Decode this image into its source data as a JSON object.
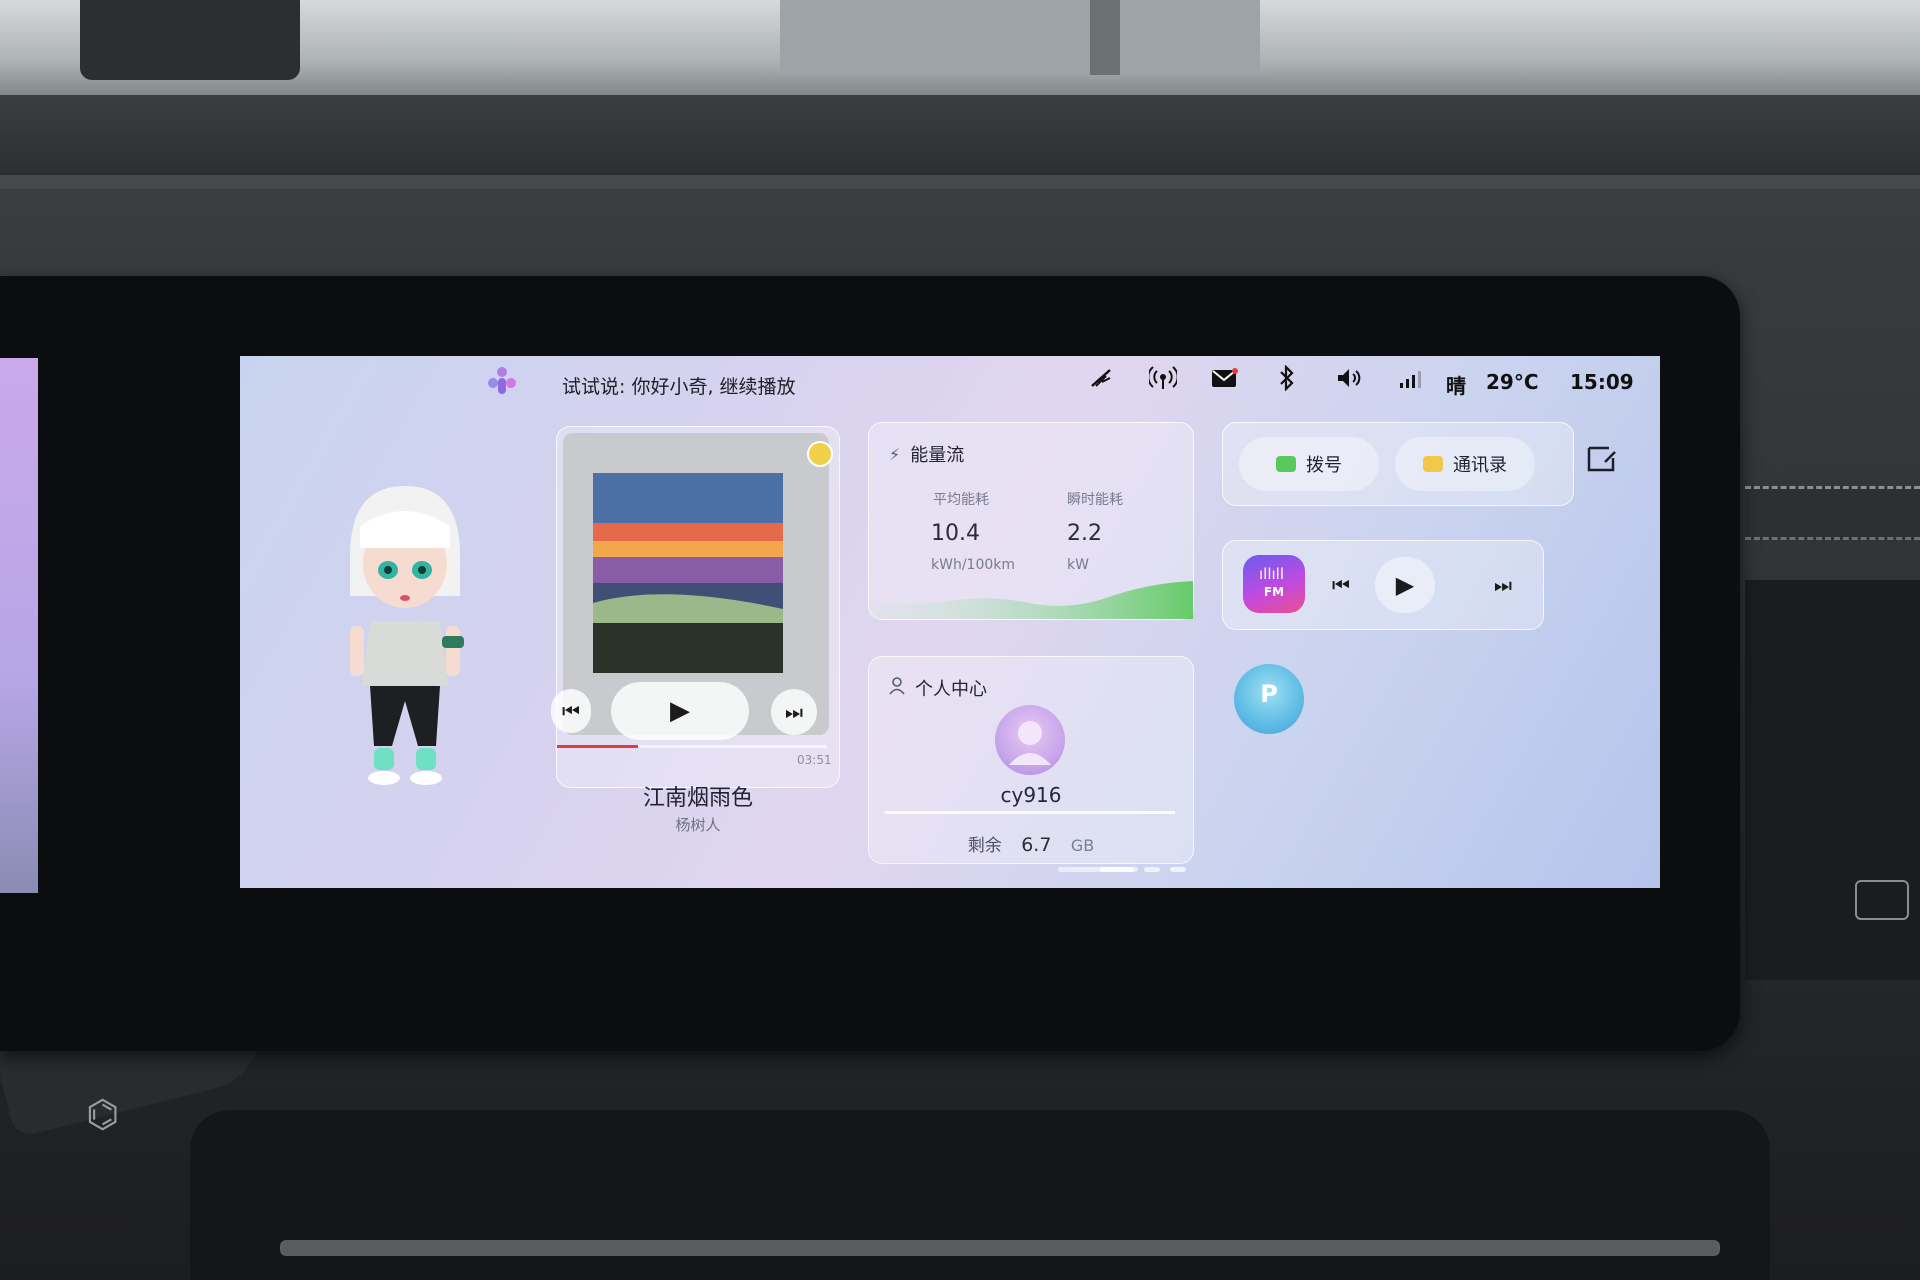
{
  "status_bar": {
    "voice_hint": "试试说: 你好小奇, 继续播放",
    "icons": [
      "wiper-icon",
      "hotspot-icon",
      "mail-icon",
      "bluetooth-icon",
      "volume-icon",
      "signal-icon"
    ],
    "weather": "晴",
    "temperature": "29°C",
    "time": "15:09"
  },
  "music": {
    "song_title": "江南烟雨色",
    "artist": "杨树人",
    "duration": "03:51",
    "progress": 0.3
  },
  "energy": {
    "title": "能量流",
    "avg_label": "平均能耗",
    "avg_value": "10.4",
    "avg_unit": "kWh/100km",
    "instant_label": "瞬时能耗",
    "instant_value": "2.2",
    "instant_unit": "kW"
  },
  "profile": {
    "title": "个人中心",
    "username": "cy916",
    "remaining_label": "剩余",
    "remaining_value": "6.7",
    "remaining_unit": "GB"
  },
  "phone": {
    "dial_label": "拨号",
    "contacts_label": "通讯录"
  },
  "radio": {
    "logo_text": "FM"
  },
  "parking": {
    "logo_text": "P"
  },
  "pager": {
    "pages": 3,
    "active": 0
  },
  "colors": {
    "accent_green": "#58c95a",
    "progress_red": "#e23c3c",
    "fm_gradient_start": "#6b5cf0",
    "fm_gradient_end": "#ea4f8f",
    "parking_blue": "#62bfe6"
  }
}
